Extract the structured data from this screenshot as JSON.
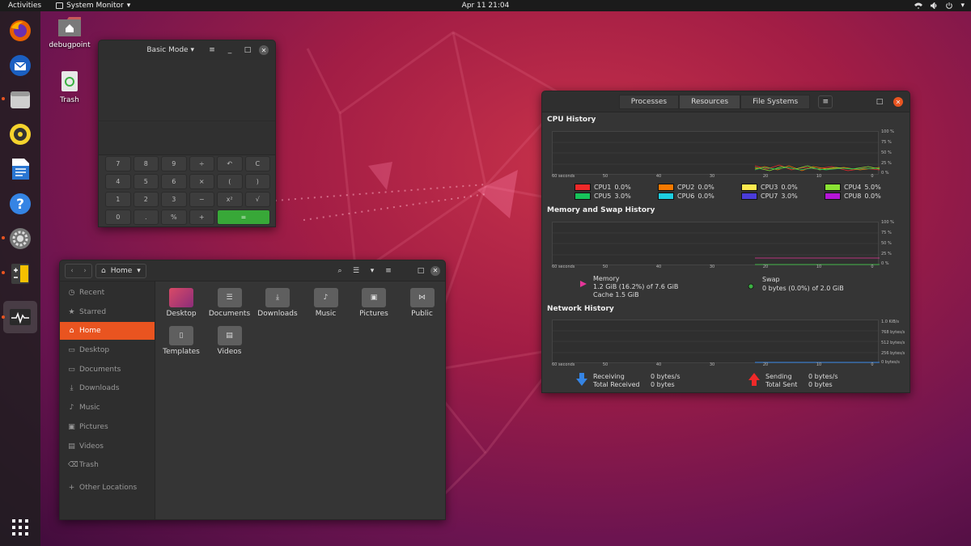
{
  "topbar": {
    "activities": "Activities",
    "app_name": "System Monitor",
    "clock": "Apr 11  21:04"
  },
  "desktop": {
    "icons": [
      {
        "label": "debugpoint"
      },
      {
        "label": "Trash"
      }
    ]
  },
  "calculator": {
    "mode": "Basic Mode",
    "keys": [
      "7",
      "8",
      "9",
      "÷",
      "↶",
      "C",
      "4",
      "5",
      "6",
      "×",
      "(",
      ")",
      "1",
      "2",
      "3",
      "−",
      "x²",
      "√",
      "0",
      ".",
      "%",
      "+",
      "="
    ]
  },
  "files": {
    "path": "Home",
    "sidebar": [
      {
        "label": "Recent",
        "icon": "clock-icon"
      },
      {
        "label": "Starred",
        "icon": "star-icon"
      },
      {
        "label": "Home",
        "icon": "home-icon",
        "active": true
      },
      {
        "label": "Desktop",
        "icon": "folder-icon"
      },
      {
        "label": "Documents",
        "icon": "folder-icon"
      },
      {
        "label": "Downloads",
        "icon": "download-icon"
      },
      {
        "label": "Music",
        "icon": "music-icon"
      },
      {
        "label": "Pictures",
        "icon": "picture-icon"
      },
      {
        "label": "Videos",
        "icon": "video-icon"
      },
      {
        "label": "Trash",
        "icon": "trash-icon"
      },
      {
        "label": "Other Locations",
        "icon": "plus-icon"
      }
    ],
    "folders": [
      "Desktop",
      "Documents",
      "Downloads",
      "Music",
      "Pictures",
      "Public",
      "Templates",
      "Videos"
    ]
  },
  "sysmon": {
    "tabs": [
      "Processes",
      "Resources",
      "File Systems"
    ],
    "active_tab": "Resources",
    "cpu": {
      "title": "CPU History",
      "y_labels": [
        "100 %",
        "75 %",
        "50 %",
        "25 %",
        "0 %"
      ],
      "x_labels": [
        "60 seconds",
        "50",
        "40",
        "30",
        "20",
        "10",
        "0"
      ],
      "cores": [
        {
          "name": "CPU1",
          "value": "0.0%",
          "color": "#ef2929"
        },
        {
          "name": "CPU2",
          "value": "0.0%",
          "color": "#f57900"
        },
        {
          "name": "CPU3",
          "value": "0.0%",
          "color": "#fce94f"
        },
        {
          "name": "CPU4",
          "value": "5.0%",
          "color": "#8ae234"
        },
        {
          "name": "CPU5",
          "value": "3.0%",
          "color": "#17c35a"
        },
        {
          "name": "CPU6",
          "value": "0.0%",
          "color": "#1ecde0"
        },
        {
          "name": "CPU7",
          "value": "3.0%",
          "color": "#4a3cd8"
        },
        {
          "name": "CPU8",
          "value": "0.0%",
          "color": "#b516d6"
        }
      ]
    },
    "memory": {
      "title": "Memory and Swap History",
      "y_labels": [
        "100 %",
        "75 %",
        "50 %",
        "25 %",
        "0 %"
      ],
      "x_labels": [
        "60 seconds",
        "50",
        "40",
        "30",
        "20",
        "10",
        "0"
      ],
      "mem_label": "Memory",
      "mem_value": "1.2 GiB (16.2%) of 7.6 GiB",
      "cache_value": "Cache 1.5 GiB",
      "swap_label": "Swap",
      "swap_value": "0 bytes (0.0%) of 2.0 GiB",
      "mem_color": "#e6369a",
      "swap_color": "#3cb043"
    },
    "network": {
      "title": "Network History",
      "y_labels": [
        "1.0 KiB/s",
        "768 bytes/s",
        "512 bytes/s",
        "256 bytes/s",
        "0 bytes/s"
      ],
      "x_labels": [
        "60 seconds",
        "50",
        "40",
        "30",
        "20",
        "10",
        "0"
      ],
      "receiving_label": "Receiving",
      "receiving_value": "0 bytes/s",
      "total_received_label": "Total Received",
      "total_received_value": "0 bytes",
      "sending_label": "Sending",
      "sending_value": "0 bytes/s",
      "total_sent_label": "Total Sent",
      "total_sent_value": "0 bytes"
    }
  }
}
